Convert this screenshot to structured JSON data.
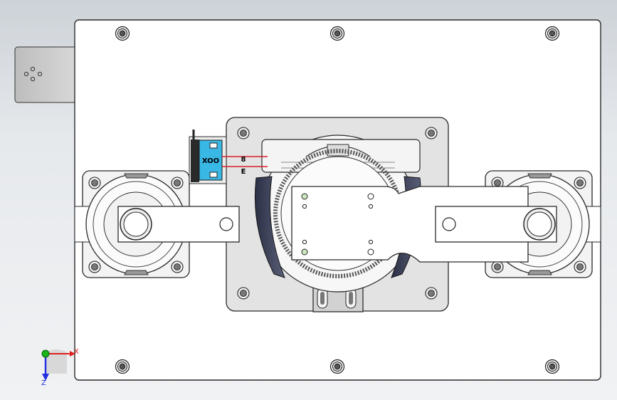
{
  "viewport": {
    "background_top": "#cdd2d8",
    "background_bottom": "#f1f2f4"
  },
  "colors": {
    "plate": "#ffffff",
    "plate_stroke": "#2a2a2a",
    "subplate": "#e3e3e3",
    "sensor_body": "#39b8e6",
    "sensor_dark": "#2a2a2a",
    "beam": "#d6202b",
    "axis_x": "#e02020",
    "axis_y": "#18b418",
    "axis_z": "#2030e0"
  },
  "sensor": {
    "label": "XOO",
    "beam_tags": [
      "8",
      "E"
    ]
  },
  "triad": {
    "x_label": "X",
    "z_label": "Z"
  },
  "icons": [
    "bolt-hole-icon",
    "bearing-icon",
    "view-triad-icon"
  ]
}
